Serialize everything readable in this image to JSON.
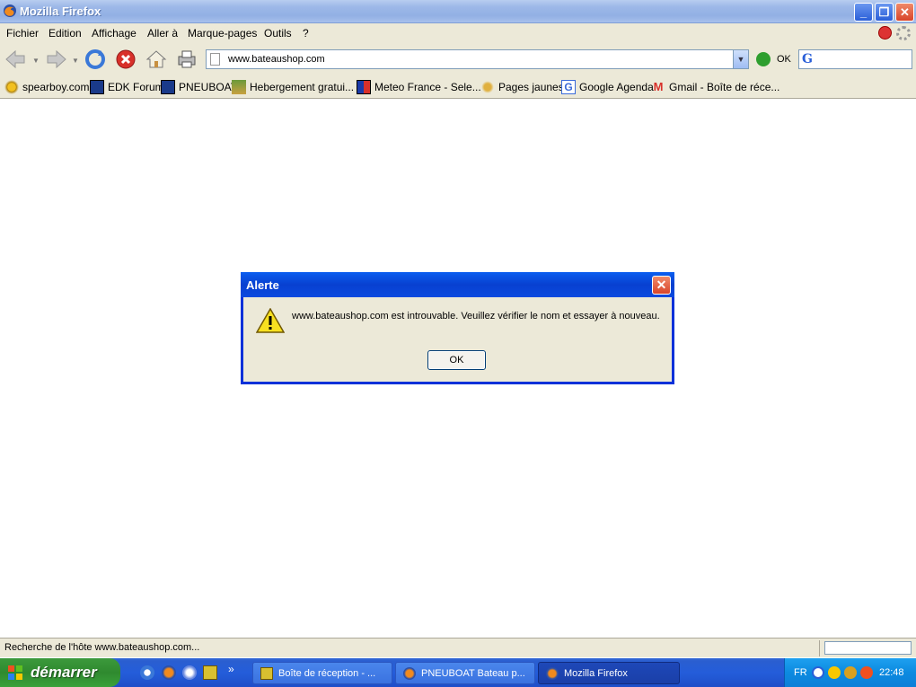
{
  "window": {
    "title": "Mozilla Firefox"
  },
  "menu": {
    "items": [
      "Fichier",
      "Edition",
      "Affichage",
      "Aller à",
      "Marque-pages",
      "Outils",
      "?"
    ]
  },
  "toolbar": {
    "url": "www.bateaushop.com",
    "go_label": "OK"
  },
  "bookmarks": [
    {
      "label": "spearboy.com",
      "icon": "sun-icon"
    },
    {
      "label": "EDK Forum",
      "icon": "pb-icon"
    },
    {
      "label": "PNEUBOAT",
      "icon": "pb-icon"
    },
    {
      "label": "Hebergement gratui...",
      "icon": "stack-icon"
    },
    {
      "label": "Meteo France - Sele...",
      "icon": "meteo-icon"
    },
    {
      "label": "Pages jaunes",
      "icon": "walker-icon"
    },
    {
      "label": "Google Agenda",
      "icon": "google-icon"
    },
    {
      "label": "Gmail - Boîte de réce...",
      "icon": "gmail-icon"
    }
  ],
  "alert": {
    "title": "Alerte",
    "message": "www.bateaushop.com est introuvable. Veuillez vérifier le nom et essayer à nouveau.",
    "ok_label": "OK"
  },
  "status": {
    "text": "Recherche de l'hôte www.bateaushop.com..."
  },
  "taskbar": {
    "start_label": "démarrer",
    "buttons": [
      {
        "label": "Boîte de réception - ...",
        "state": "inactive"
      },
      {
        "label": "PNEUBOAT Bateau p...",
        "state": "inactive"
      },
      {
        "label": "Mozilla Firefox",
        "state": "active"
      }
    ],
    "lang": "FR",
    "clock": "22:48",
    "overflow": "»"
  },
  "colors": {
    "xp_blue": "#245dda",
    "start_green": "#2f8a2f",
    "dialog_border": "#0831d9",
    "chrome": "#ece9d8"
  }
}
